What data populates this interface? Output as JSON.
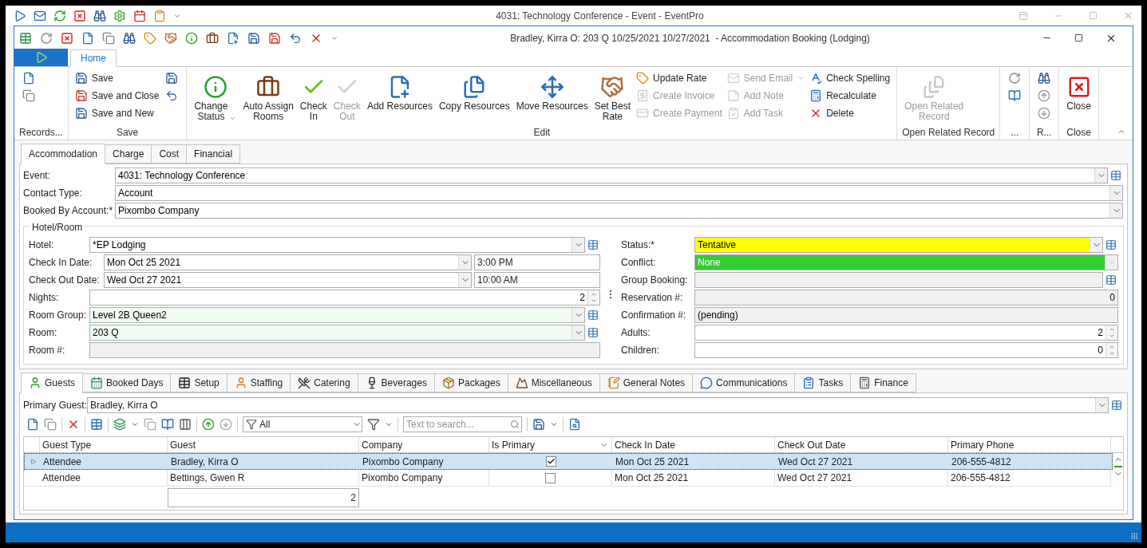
{
  "app_title": "4031: Technology Conference - Event - EventPro",
  "window": {
    "title": "Bradley, Kirra O: 203 Q 10/25/2021 10/27/2021  - Accommodation Booking (Lodging)"
  },
  "ribbon": {
    "tabs": [
      {
        "label": "Home",
        "selected": true
      }
    ],
    "groups": [
      {
        "label": "Records...",
        "columns": [
          [
            {
              "kind": "icon",
              "disabled": false
            },
            {
              "kind": "icon",
              "disabled": false
            }
          ]
        ]
      },
      {
        "label": "Save",
        "columns": [
          [
            {
              "kind": "small",
              "label": "Save",
              "disabled": false,
              "dropdown": false
            },
            {
              "kind": "small",
              "label": "Save and Close",
              "disabled": false,
              "dropdown": false
            },
            {
              "kind": "small",
              "label": "Save and New",
              "disabled": false,
              "dropdown": false
            }
          ],
          [
            {
              "kind": "icon",
              "disabled": false
            },
            {
              "kind": "icon",
              "disabled": false
            }
          ]
        ]
      },
      {
        "label": "Edit",
        "columns": [
          [
            {
              "kind": "large",
              "label": "Change\nStatus",
              "disabled": false,
              "dropdown": true
            }
          ],
          [
            {
              "kind": "large",
              "label": "Auto Assign\nRooms",
              "disabled": false,
              "dropdown": false
            }
          ],
          [
            {
              "kind": "large",
              "label": "Check\nIn",
              "disabled": false,
              "dropdown": false
            }
          ],
          [
            {
              "kind": "large",
              "label": "Check\nOut",
              "disabled": true,
              "dropdown": false
            }
          ],
          [
            {
              "kind": "large",
              "label": "Add Resources",
              "disabled": false,
              "dropdown": false
            }
          ],
          [
            {
              "kind": "large",
              "label": "Copy Resources",
              "disabled": false,
              "dropdown": false
            }
          ],
          [
            {
              "kind": "large",
              "label": "Move Resources",
              "disabled": false,
              "dropdown": false
            }
          ],
          [
            {
              "kind": "large",
              "label": "Set Best\nRate",
              "disabled": false,
              "dropdown": false
            }
          ],
          [
            {
              "kind": "small",
              "label": "Update Rate",
              "disabled": false,
              "dropdown": false
            },
            {
              "kind": "small",
              "label": "Create Invoice",
              "disabled": true,
              "dropdown": false
            },
            {
              "kind": "small",
              "label": "Create Payment",
              "disabled": true,
              "dropdown": false
            }
          ],
          [
            {
              "kind": "small",
              "label": "Send Email",
              "disabled": true,
              "dropdown": true
            },
            {
              "kind": "small",
              "label": "Add Note",
              "disabled": true,
              "dropdown": false
            },
            {
              "kind": "small",
              "label": "Add Task",
              "disabled": true,
              "dropdown": false
            }
          ],
          [
            {
              "kind": "small",
              "label": "Check Spelling",
              "disabled": false,
              "dropdown": false
            },
            {
              "kind": "small",
              "label": "Recalculate",
              "disabled": false,
              "dropdown": false
            },
            {
              "kind": "small",
              "label": "Delete",
              "disabled": false,
              "dropdown": false
            }
          ]
        ]
      },
      {
        "label": "Open Related Record",
        "columns": [
          [
            {
              "kind": "large",
              "label": "Open Related\nRecord",
              "disabled": true,
              "dropdown": false
            }
          ]
        ]
      },
      {
        "label": "...",
        "columns": [
          [
            {
              "kind": "icon",
              "disabled": false
            },
            {
              "kind": "icon",
              "disabled": false
            }
          ]
        ]
      },
      {
        "label": "R...",
        "columns": [
          [
            {
              "kind": "icon",
              "disabled": false
            },
            {
              "kind": "icon",
              "disabled": false
            },
            {
              "kind": "icon",
              "disabled": false
            }
          ]
        ]
      },
      {
        "label": "Close",
        "columns": [
          [
            {
              "kind": "large",
              "label": "Close",
              "disabled": false,
              "dropdown": false
            }
          ]
        ]
      }
    ]
  },
  "form_tabs": [
    {
      "label": "Accommodation",
      "selected": true
    },
    {
      "label": "Charge",
      "selected": false
    },
    {
      "label": "Cost",
      "selected": false
    },
    {
      "label": "Financial",
      "selected": false
    }
  ],
  "account_fields": [
    {
      "label": "Event:",
      "value": "4031: Technology Conference",
      "dropdown": true,
      "lookup": true
    },
    {
      "label": "Contact Type:",
      "value": "Account",
      "dropdown": true,
      "lookup": false
    },
    {
      "label": "Booked By Account:*",
      "value": "Pixombo Company",
      "dropdown": true,
      "lookup": false
    }
  ],
  "hotel_room": {
    "title": "Hotel/Room",
    "left_fields": [
      {
        "label": "Hotel:",
        "value": "*EP Lodging",
        "kind": "text",
        "dropdown": true,
        "lookup": true,
        "readonly": false,
        "highlight": false
      },
      {
        "label": "Check In Date:",
        "value": "Mon Oct 25 2021",
        "time": "3:00 PM",
        "kind": "text",
        "dropdown": true,
        "lookup": false,
        "readonly": false,
        "highlight": false
      },
      {
        "label": "Check Out Date:",
        "value": "Wed Oct 27 2021",
        "time": "10:00 AM",
        "kind": "text",
        "dropdown": true,
        "lookup": false,
        "readonly": false,
        "highlight": false
      },
      {
        "label": "Nights:",
        "value": "2",
        "kind": "spin",
        "dropdown": false,
        "lookup": false,
        "readonly": false,
        "highlight": false
      },
      {
        "label": "Room Group:",
        "value": "Level 2B Queen2",
        "kind": "text",
        "dropdown": true,
        "lookup": true,
        "readonly": false,
        "highlight": true
      },
      {
        "label": "Room:",
        "value": "203 Q",
        "kind": "text",
        "dropdown": true,
        "lookup": true,
        "readonly": false,
        "highlight": true
      },
      {
        "label": "Room #:",
        "kind": "text",
        "dropdown": false,
        "lookup": false,
        "readonly": true
      }
    ],
    "right_fields": [
      {
        "label": "Status:*",
        "value": "Tentative",
        "kind": "text",
        "dropdown": true,
        "lookup": true,
        "readonly": false,
        "color": "#ffff00"
      },
      {
        "label": "Conflict:",
        "value": "None",
        "kind": "text",
        "dropdown": true,
        "lookup": false,
        "readonly": true,
        "color": "#33cc33"
      },
      {
        "label": "Group Booking:",
        "kind": "text",
        "dropdown": false,
        "lookup": true,
        "readonly": true
      },
      {
        "label": "Reservation #:",
        "value": "0",
        "kind": "number",
        "dropdown": false,
        "lookup": false,
        "readonly": true
      },
      {
        "label": "Confirmation #:",
        "value": "(pending)",
        "kind": "text",
        "dropdown": false,
        "lookup": false,
        "readonly": true
      },
      {
        "label": "Adults:",
        "value": "2",
        "kind": "spin",
        "dropdown": false,
        "lookup": false,
        "readonly": false,
        "highlight": false
      },
      {
        "label": "Children:",
        "value": "0",
        "kind": "spin",
        "dropdown": false,
        "lookup": false,
        "readonly": false,
        "highlight": false
      }
    ]
  },
  "detail_tabs": [
    {
      "label": "Guests",
      "selected": true
    },
    {
      "label": "Booked Days",
      "selected": false
    },
    {
      "label": "Setup",
      "selected": false
    },
    {
      "label": "Staffing",
      "selected": false
    },
    {
      "label": "Catering",
      "selected": false
    },
    {
      "label": "Beverages",
      "selected": false
    },
    {
      "label": "Packages",
      "selected": false
    },
    {
      "label": "Miscellaneous",
      "selected": false
    },
    {
      "label": "General Notes",
      "selected": false
    },
    {
      "label": "Communications",
      "selected": false
    },
    {
      "label": "Tasks",
      "selected": false
    },
    {
      "label": "Finance",
      "selected": false
    }
  ],
  "primary_guest": {
    "label": "Primary Guest:",
    "value": "Bradley, Kirra O"
  },
  "toolbar": {
    "filter": {
      "value": "All"
    },
    "search": {
      "placeholder": "Text to search..."
    }
  },
  "grid": {
    "columns": [
      {
        "label": "Guest Type",
        "filter": false
      },
      {
        "label": "Guest",
        "filter": false
      },
      {
        "label": "Company",
        "filter": false
      },
      {
        "label": "Is Primary",
        "filter": true
      },
      {
        "label": "Check In Date",
        "filter": false
      },
      {
        "label": "Check Out Date",
        "filter": false
      },
      {
        "label": "Primary Phone",
        "filter": false
      }
    ],
    "rows": [
      {
        "selected": true,
        "guest_type": "Attendee",
        "guest": "Bradley, Kirra O",
        "company": "Pixombo Company",
        "is_primary": true,
        "check_in": "Mon Oct 25 2021",
        "check_out": "Wed Oct 27 2021",
        "phone": "206-555-4812"
      },
      {
        "selected": false,
        "guest_type": "Attendee",
        "guest": "Bettings, Gwen R",
        "company": "Pixombo Company",
        "is_primary": false,
        "check_in": "Mon Oct 25 2021",
        "check_out": "Wed Oct 27 2021",
        "phone": "206-555-4812"
      }
    ],
    "footer_count": "2"
  }
}
